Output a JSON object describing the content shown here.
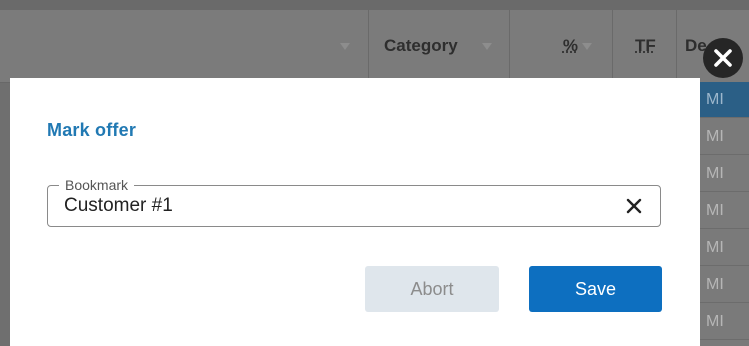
{
  "table": {
    "columns": [
      {
        "label": "",
        "filter": true
      },
      {
        "label": "Category",
        "filter": true
      },
      {
        "label": "%",
        "filter": true
      },
      {
        "label": "TF",
        "filter": false
      },
      {
        "label": "De…",
        "filter": false
      }
    ],
    "right_column_cells": [
      "MI",
      "MI",
      "MI",
      "MI",
      "MI",
      "MI",
      "MI"
    ]
  },
  "modal": {
    "title": "Mark offer",
    "bookmark_field": {
      "label": "Bookmark",
      "value": "Customer #1"
    },
    "abort_label": "Abort",
    "save_label": "Save"
  },
  "colors": {
    "primary": "#0d6fc0",
    "title": "#2179b3",
    "abort_bg": "#dfe6ec"
  },
  "icons": {
    "close": "close-icon",
    "clear": "clear-input-icon",
    "filter": "filter-icon"
  }
}
